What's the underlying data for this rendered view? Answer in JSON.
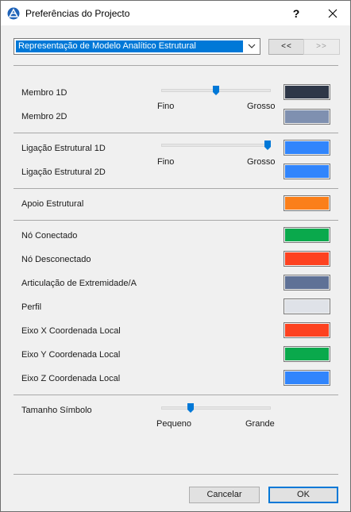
{
  "window": {
    "title": "Preferências do Projecto",
    "help": "?",
    "close": "✕"
  },
  "header": {
    "selected_representation": "Representação de Modelo Analítico Estrutural",
    "prev_label": "<<",
    "next_label": ">>"
  },
  "group1": {
    "member_1d": {
      "label": "Membro 1D",
      "color": "#2e3748"
    },
    "member_2d": {
      "label": "Membro 2D",
      "color": "#7f90b0"
    },
    "slider": {
      "min_label": "Fino",
      "max_label": "Grosso",
      "level": 0.5
    }
  },
  "group2": {
    "link_1d": {
      "label": "Ligação Estrutural 1D",
      "color": "#3185fc"
    },
    "link_2d": {
      "label": "Ligação Estrutural 2D",
      "color": "#3185fc"
    },
    "slider": {
      "min_label": "Fino",
      "max_label": "Grosso",
      "level": 1.0
    }
  },
  "group3": {
    "support": {
      "label": "Apoio Estrutural",
      "color": "#fb7f1a"
    }
  },
  "group4": {
    "items": [
      {
        "label": "Nó Conectado",
        "color": "#0aa94c"
      },
      {
        "label": "Nó Desconectado",
        "color": "#fd4220"
      },
      {
        "label": "Articulação de Extremidade/A",
        "color": "#5f7196"
      },
      {
        "label": "Perfil",
        "color": "#dfe2e8"
      },
      {
        "label": "Eixo X Coordenada Local",
        "color": "#fd4220"
      },
      {
        "label": "Eixo Y Coordenada Local",
        "color": "#0aa94c"
      },
      {
        "label": "Eixo Z Coordenada Local",
        "color": "#3185fc"
      }
    ]
  },
  "symbol_size": {
    "label": "Tamanho Símbolo",
    "min_label": "Pequeno",
    "max_label": "Grande",
    "level": 0.25
  },
  "footer": {
    "cancel_label": "Cancelar",
    "ok_label": "OK"
  },
  "colors": {
    "accent": "#0078d7"
  }
}
